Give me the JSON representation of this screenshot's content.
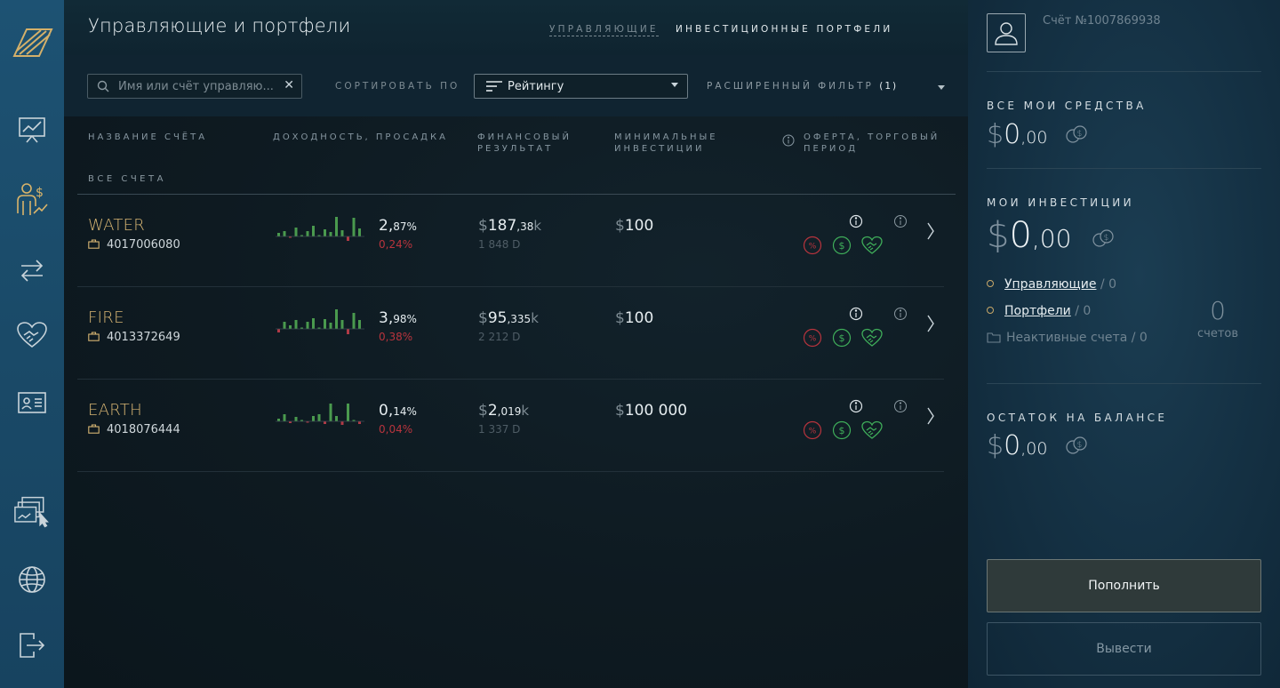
{
  "header": {
    "title": "Управляющие и портфели",
    "tabs": [
      {
        "label": "Управляющие",
        "active": true
      },
      {
        "label": "Инвестиционные портфели",
        "active": false
      }
    ]
  },
  "filters": {
    "search_placeholder": "Имя или счёт управляю...",
    "sort_label": "Сортировать по",
    "sort_value": "Рейтингу",
    "advanced_filter_label": "Расширенный фильтр",
    "advanced_filter_count": "(1)"
  },
  "table": {
    "columns": [
      "Название счёта",
      "Доходность, просадка",
      "Финансовый результат",
      "Минимальные инвестиции",
      "Оферта, торговый период"
    ],
    "group_label": "ВСЕ СЧЕТА",
    "rows": [
      {
        "name": "WATER",
        "account": "4017006080",
        "yield_int": "2,",
        "yield_dec": "87%",
        "drawdown": "0,24%",
        "fin_cur": "$",
        "fin_int": "187",
        "fin_dec": ",38",
        "fin_suffix": "k",
        "days": "1 848 D",
        "min_cur": "$",
        "min_val": "100",
        "spark": [
          4,
          6,
          -1,
          10,
          0,
          6,
          12,
          0,
          8,
          5,
          22,
          7,
          -5,
          21,
          9
        ]
      },
      {
        "name": "FIRE",
        "account": "4013372649",
        "yield_int": "3,",
        "yield_dec": "98%",
        "drawdown": "0,38%",
        "fin_cur": "$",
        "fin_int": "95",
        "fin_dec": ",335",
        "fin_suffix": "k",
        "days": "2 212 D",
        "min_cur": "$",
        "min_val": "100",
        "spark": [
          -4,
          8,
          4,
          10,
          0,
          8,
          12,
          0,
          11,
          7,
          22,
          10,
          -6,
          18,
          10
        ]
      },
      {
        "name": "EARTH",
        "account": "4018076444",
        "yield_int": "0,",
        "yield_dec": "14%",
        "drawdown": "0,04%",
        "fin_cur": "$",
        "fin_int": "2",
        "fin_dec": ",019",
        "fin_suffix": "k",
        "days": "1 337 D",
        "min_cur": "$",
        "min_val": "100 000",
        "spark": [
          3,
          8,
          -2,
          5,
          0,
          -1,
          6,
          8,
          -3,
          20,
          6,
          -4,
          20,
          0,
          -3
        ]
      }
    ]
  },
  "side": {
    "account_label": "Счёт №1007869938",
    "total_title": "Все мои средства",
    "total_cur": "$",
    "total_int": "0",
    "total_dec": ",00",
    "invest_title": "Мои инвестиции",
    "invest_cur": "$",
    "invest_int": "0",
    "invest_dec": ",00",
    "managers_link": "Управляющие",
    "managers_count": "/ 0",
    "portfolios_link": "Портфели",
    "portfolios_count": "/ 0",
    "inactive_label": "Неактивные счета / 0",
    "accounts_count": "0",
    "accounts_label": "счетов",
    "balance_title": "Остаток на балансе",
    "balance_cur": "$",
    "balance_int": "0",
    "balance_dec": ",00",
    "topup_label": "Пополнить",
    "withdraw_label": "Вывести"
  },
  "colors": {
    "gold": "#d7b573",
    "red": "#b8343d",
    "green": "#3fae5a",
    "rail": "#1d5273"
  },
  "icons": {
    "rail": [
      "logo-icon",
      "chart-board-icon",
      "manager-money-icon",
      "transfer-arrows-icon",
      "handshake-heart-icon",
      "id-card-icon",
      "cards-pointer-icon",
      "globe-icon",
      "logout-icon"
    ],
    "badges": [
      "percent-icon",
      "dollar-icon",
      "handshake-icon"
    ]
  }
}
